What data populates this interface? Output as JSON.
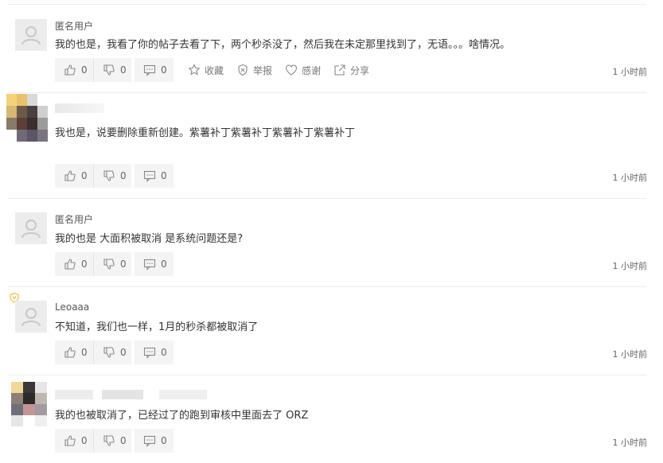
{
  "comments": [
    {
      "user": "匿名用户",
      "text": "我的也是，我看了你的帖子去看了下，两个秒杀没了，然后我在未定那里找到了，无语。。。啥情况。",
      "likes": "0",
      "dislikes": "0",
      "replies": "0",
      "collect": "收藏",
      "report": "举报",
      "thanks": "感谢",
      "share": "分享",
      "time": "1 小时前"
    },
    {
      "user": "",
      "text": "我也是，说要删除重新创建。紫薯补丁紫薯补丁紫薯补丁紫薯补丁",
      "likes": "0",
      "dislikes": "0",
      "replies": "0",
      "time": "1 小时前"
    },
    {
      "user": "匿名用户",
      "text": "我的也是 大面积被取消 是系统问题还是?",
      "likes": "0",
      "dislikes": "0",
      "replies": "0",
      "time": "1 小时前"
    },
    {
      "user": "Leoaaa",
      "text": "不知道，我们也一样，1月的秒杀都被取消了",
      "likes": "0",
      "dislikes": "0",
      "replies": "0",
      "time": "1 小时前"
    },
    {
      "user": "",
      "text": "我的也被取消了，已经过了的跑到审核中里面去了  ORZ",
      "likes": "0",
      "dislikes": "0",
      "replies": "0",
      "time": "1 小时前"
    }
  ],
  "icons": {
    "like": "thumbs-up-icon",
    "dislike": "thumbs-down-icon",
    "reply": "comment-icon",
    "collect": "star-icon",
    "report": "report-shield-icon",
    "thanks": "heart-icon",
    "share": "share-icon",
    "avatar": "default-user-icon",
    "verified": "verified-badge-icon"
  },
  "colors": {
    "button_bg": "#f4f4f4",
    "divider": "#ececec",
    "badge": "#f0b429"
  }
}
